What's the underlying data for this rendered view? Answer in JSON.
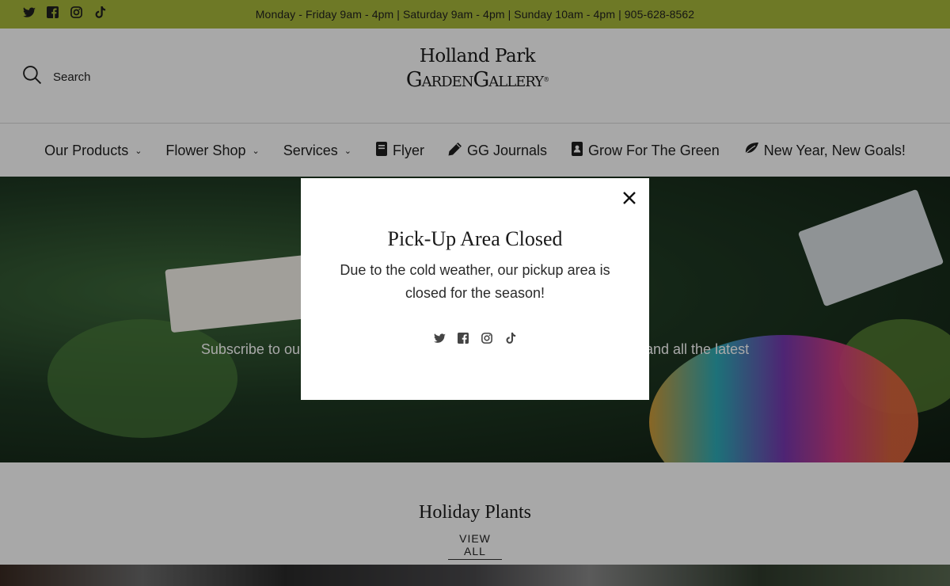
{
  "topbar": {
    "hours": "Monday - Friday 9am - 4pm | Saturday 9am - 4pm | Sunday 10am - 4pm | 905-628-8562",
    "social": [
      "twitter-icon",
      "facebook-icon",
      "instagram-icon",
      "tiktok-icon"
    ],
    "background": "#a8b83a"
  },
  "header": {
    "search_label": "Search",
    "logo_line1": "Holland Park",
    "logo_line2": "GardenGallery",
    "logo_mark": "®"
  },
  "nav": {
    "items": [
      {
        "label": "Our Products",
        "has_dropdown": true
      },
      {
        "label": "Flower Shop",
        "has_dropdown": true
      },
      {
        "label": "Services",
        "has_dropdown": true
      },
      {
        "label": "Flyer",
        "icon": "book-icon"
      },
      {
        "label": "GG Journals",
        "icon": "pencil-icon"
      },
      {
        "label": "Grow For The Green",
        "icon": "contact-book-icon"
      },
      {
        "label": "New Year, New Goals!",
        "icon": "leaf-icon"
      }
    ]
  },
  "hero": {
    "subscribe_text_left": "Subscribe to our",
    "subscribe_text_right": "and all the latest"
  },
  "section": {
    "title": "Holiday Plants",
    "view_all": "VIEW ALL"
  },
  "modal": {
    "title": "Pick-Up Area Closed",
    "body": "Due to the cold weather, our pickup area is closed for the season!",
    "social": [
      "twitter-icon",
      "facebook-icon",
      "instagram-icon",
      "tiktok-icon"
    ]
  }
}
